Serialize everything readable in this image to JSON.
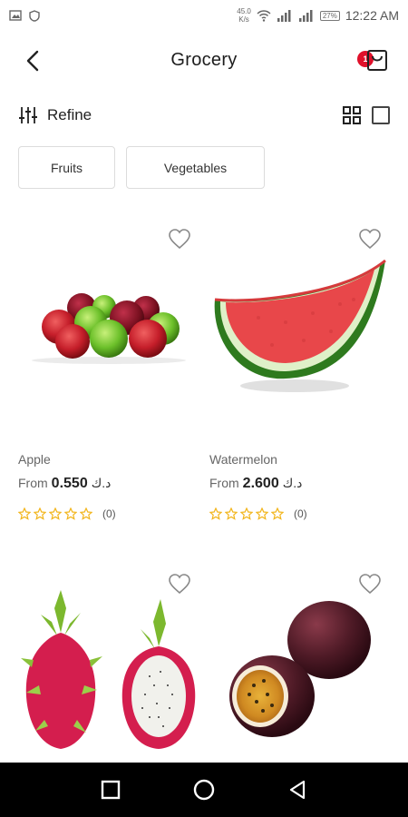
{
  "status_bar": {
    "speed_value": "45.0",
    "speed_unit": "K/s",
    "battery": "27%",
    "time": "12:22 AM"
  },
  "header": {
    "title": "Grocery",
    "cart_count": "1"
  },
  "toolbar": {
    "refine_label": "Refine"
  },
  "chips": [
    {
      "label": "Fruits"
    },
    {
      "label": "Vegetables"
    }
  ],
  "products": [
    {
      "name": "Apple",
      "price_prefix": "From",
      "price": "0.550",
      "currency": "د.ك",
      "rating": 0,
      "rating_count": "(0)"
    },
    {
      "name": "Watermelon",
      "price_prefix": "From",
      "price": "2.600",
      "currency": "د.ك",
      "rating": 0,
      "rating_count": "(0)"
    },
    {
      "name": "",
      "price_prefix": "",
      "price": "",
      "currency": "",
      "rating": 0,
      "rating_count": ""
    },
    {
      "name": "",
      "price_prefix": "",
      "price": "",
      "currency": "",
      "rating": 0,
      "rating_count": ""
    }
  ],
  "colors": {
    "accent_badge": "#e0102a",
    "star": "#f2b51b",
    "nav_bar": "#000000"
  }
}
